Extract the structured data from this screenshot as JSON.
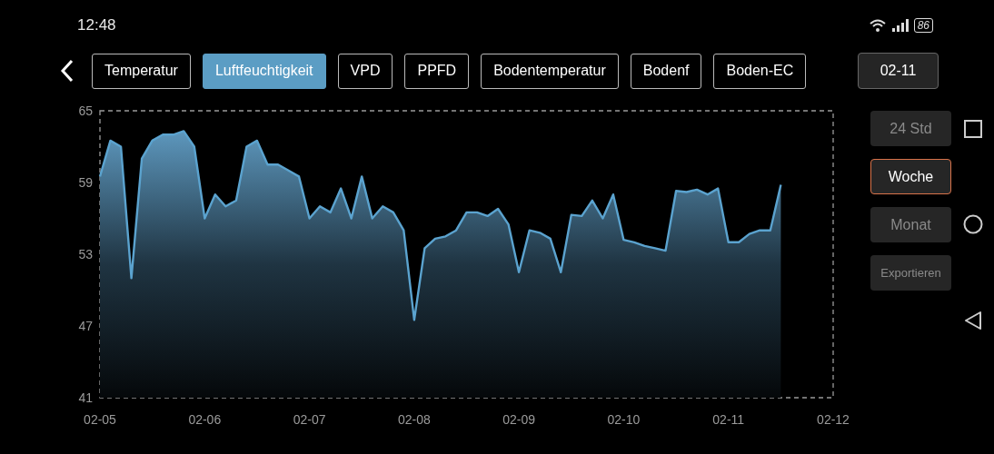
{
  "status_bar": {
    "time": "12:48",
    "battery": "86"
  },
  "tabs": [
    {
      "label": "Temperatur",
      "selected": false
    },
    {
      "label": "Luftfeuchtigkeit",
      "selected": true
    },
    {
      "label": "VPD",
      "selected": false
    },
    {
      "label": "PPFD",
      "selected": false
    },
    {
      "label": "Bodentemperatur",
      "selected": false
    },
    {
      "label": "Bodenf",
      "selected": false
    },
    {
      "label": "Boden-EC",
      "selected": false
    }
  ],
  "date_button": "02-11",
  "ranges": [
    {
      "label": "24 Std",
      "selected": false
    },
    {
      "label": "Woche",
      "selected": true
    },
    {
      "label": "Monat",
      "selected": false
    }
  ],
  "export_button": "Exportieren",
  "chart": {
    "chart_data": {
      "type": "area",
      "ylim": [
        41,
        65
      ],
      "yticks": [
        41,
        47,
        53,
        59,
        65
      ],
      "categories": [
        "02-05",
        null,
        null,
        null,
        null,
        null,
        null,
        null,
        null,
        null,
        "02-06",
        null,
        null,
        null,
        null,
        null,
        null,
        null,
        null,
        null,
        "02-07",
        null,
        null,
        null,
        null,
        null,
        null,
        null,
        null,
        null,
        "02-08",
        null,
        null,
        null,
        null,
        null,
        null,
        null,
        null,
        null,
        "02-09",
        null,
        null,
        null,
        null,
        null,
        null,
        null,
        null,
        null,
        "02-10",
        null,
        null,
        null,
        null,
        null,
        null,
        null,
        null,
        null,
        "02-11",
        null,
        null,
        null,
        null,
        null,
        null,
        null,
        null,
        null,
        "02-12"
      ],
      "series": [
        {
          "color": "#5ba3cf",
          "values": [
            59.5,
            62.5,
            62,
            51,
            61,
            62.5,
            63,
            63,
            63.3,
            62,
            56,
            58,
            57,
            57.5,
            62,
            62.5,
            60.5,
            60.5,
            60,
            59.5,
            56,
            57,
            56.5,
            58.5,
            56,
            59.5,
            56,
            57,
            56.5,
            55,
            47.5,
            53.5,
            54.3,
            54.5,
            55,
            56.5,
            56.5,
            56.2,
            56.8,
            55.5,
            51.5,
            55,
            54.8,
            54.3,
            51.5,
            56.3,
            56.2,
            57.5,
            56,
            58,
            54.2,
            54,
            53.7,
            53.5,
            53.3,
            58.3,
            58.2,
            58.4,
            58,
            58.5,
            54,
            54,
            54.7,
            55,
            55,
            58.8,
            null,
            null,
            null,
            null,
            null
          ]
        }
      ]
    }
  }
}
